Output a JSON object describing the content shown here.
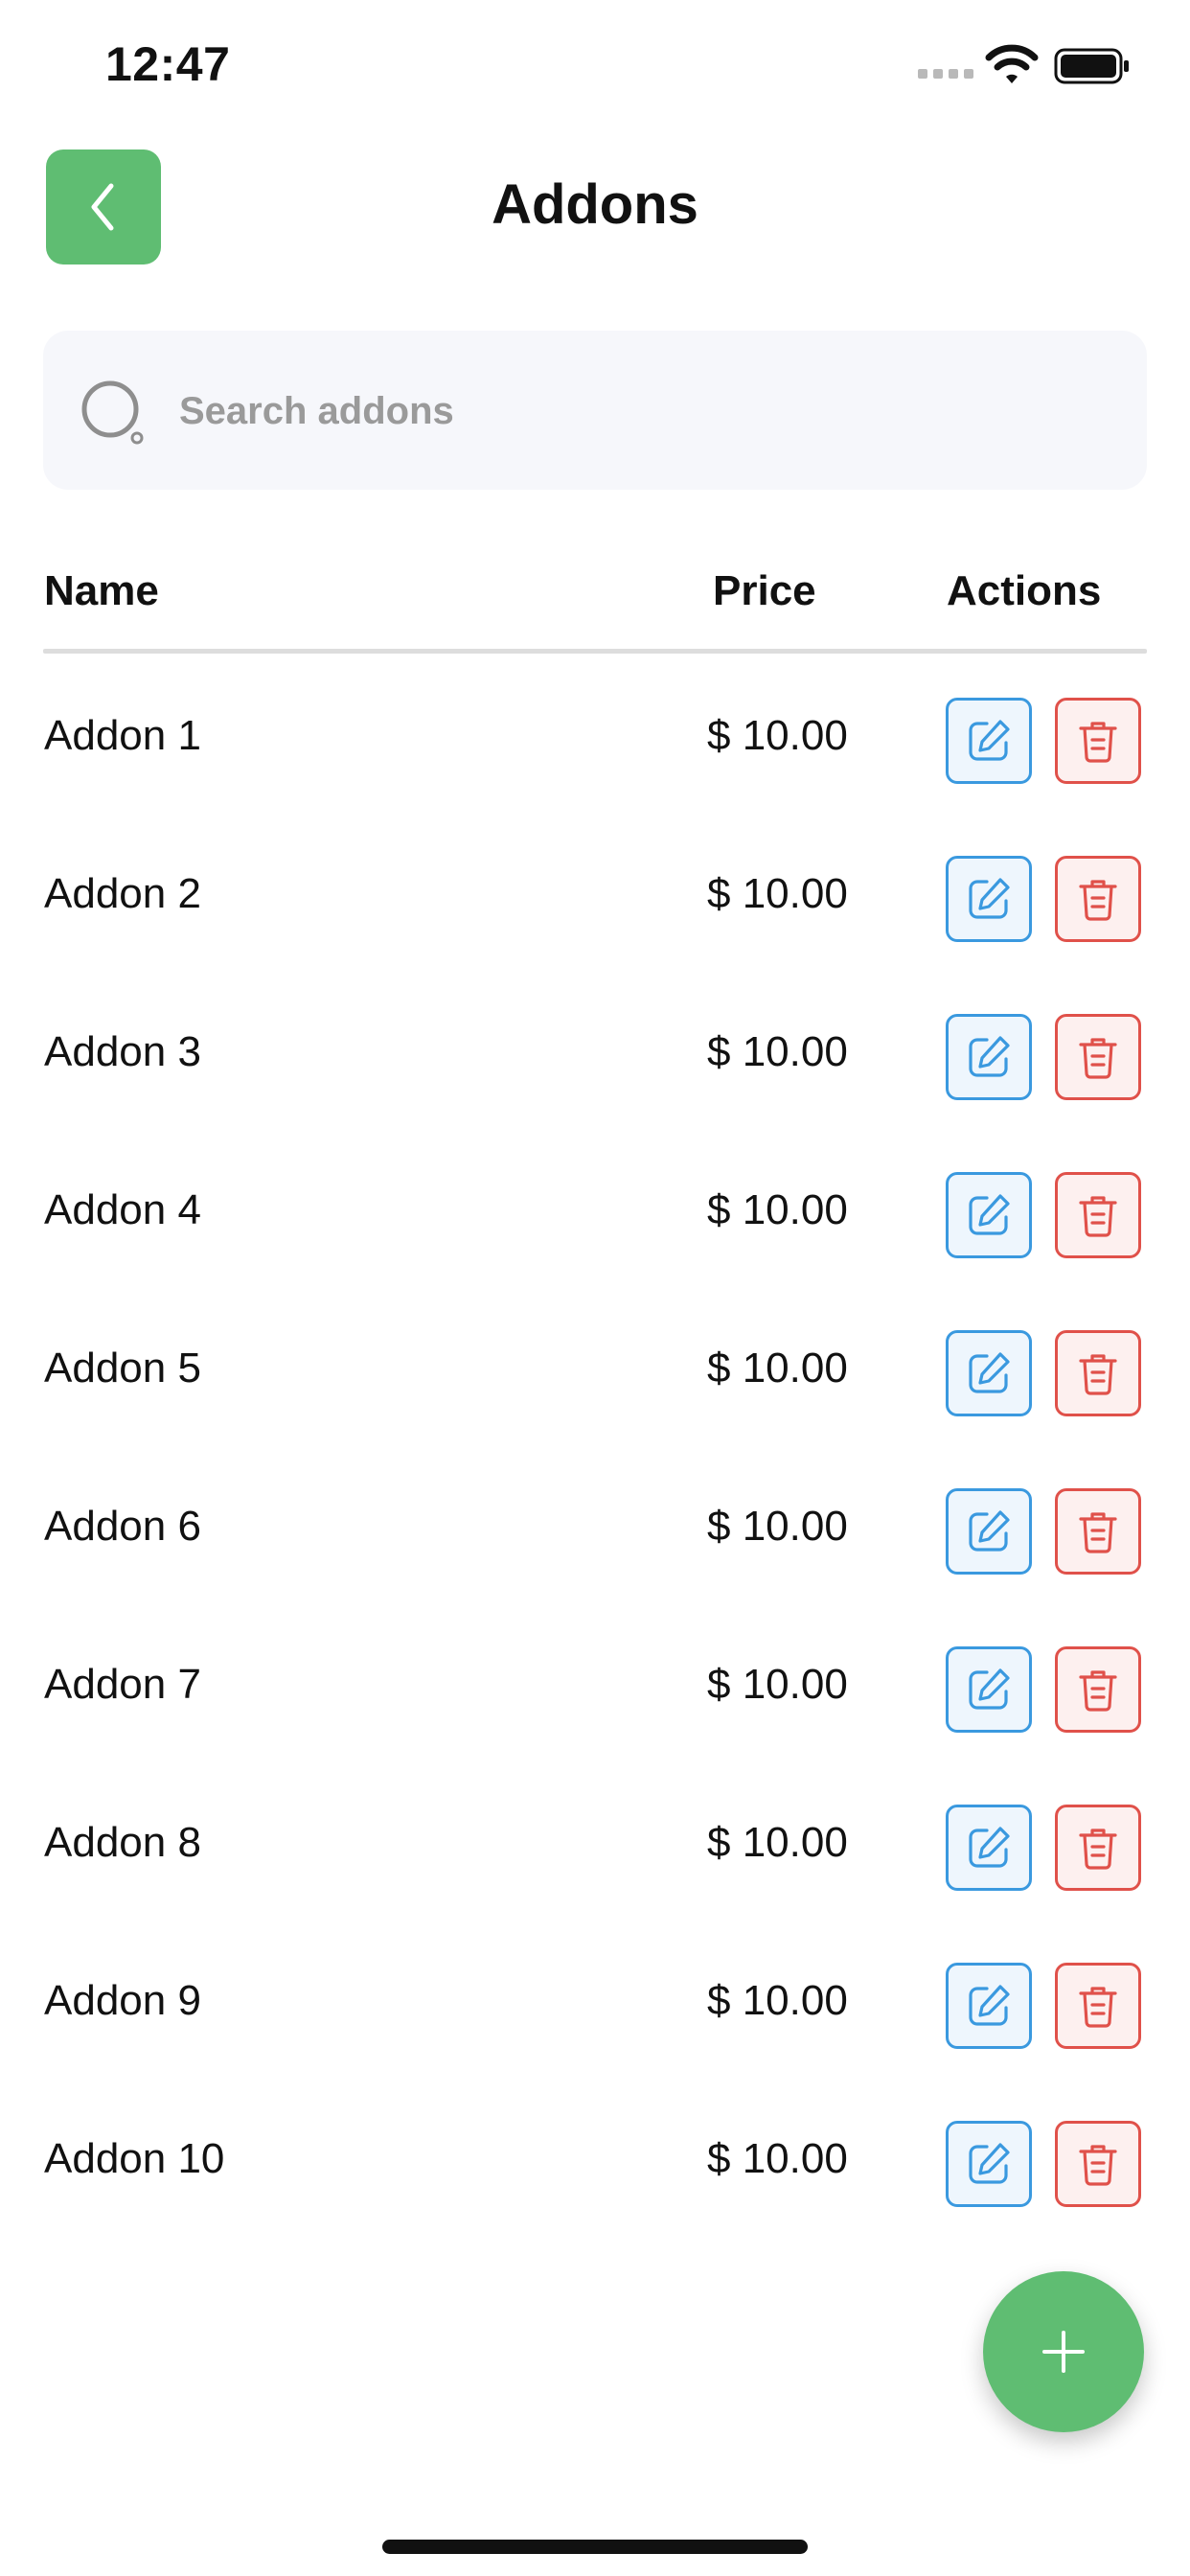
{
  "status_bar": {
    "time": "12:47"
  },
  "header": {
    "title": "Addons",
    "back_icon": "chevron-left-icon"
  },
  "search": {
    "placeholder": "Search addons",
    "value": ""
  },
  "table": {
    "columns": {
      "name": "Name",
      "price": "Price",
      "actions": "Actions"
    },
    "rows": [
      {
        "name": "Addon 1",
        "price": "$ 10.00"
      },
      {
        "name": "Addon 2",
        "price": "$ 10.00"
      },
      {
        "name": "Addon 3",
        "price": "$ 10.00"
      },
      {
        "name": "Addon 4",
        "price": "$ 10.00"
      },
      {
        "name": "Addon 5",
        "price": "$ 10.00"
      },
      {
        "name": "Addon 6",
        "price": "$ 10.00"
      },
      {
        "name": "Addon 7",
        "price": "$ 10.00"
      },
      {
        "name": "Addon 8",
        "price": "$ 10.00"
      },
      {
        "name": "Addon 9",
        "price": "$ 10.00"
      },
      {
        "name": "Addon 10",
        "price": "$ 10.00"
      }
    ],
    "row_actions": [
      "edit-icon",
      "trash-icon"
    ]
  },
  "fab": {
    "icon": "plus-icon"
  },
  "colors": {
    "primary_green": "#5fbd72",
    "edit_blue": "#3a99df",
    "delete_red": "#e0514a",
    "search_bg": "#f6f7fb"
  }
}
